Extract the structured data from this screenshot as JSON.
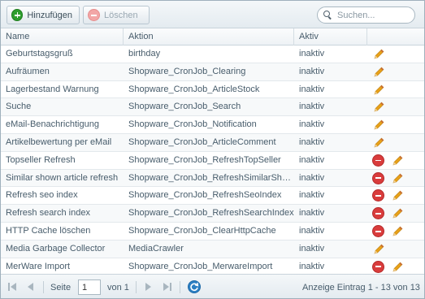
{
  "toolbar": {
    "add_label": "Hinzufügen",
    "delete_label": "Löschen",
    "search_placeholder": "Suchen..."
  },
  "grid": {
    "columns": [
      "Name",
      "Aktion",
      "Aktiv",
      ""
    ],
    "rows": [
      {
        "name": "Geburtstagsgruß",
        "action": "birthday",
        "active": "inaktiv",
        "deletable": false
      },
      {
        "name": "Aufräumen",
        "action": "Shopware_CronJob_Clearing",
        "active": "inaktiv",
        "deletable": false
      },
      {
        "name": "Lagerbestand Warnung",
        "action": "Shopware_CronJob_ArticleStock",
        "active": "inaktiv",
        "deletable": false
      },
      {
        "name": "Suche",
        "action": "Shopware_CronJob_Search",
        "active": "inaktiv",
        "deletable": false
      },
      {
        "name": "eMail-Benachrichtigung",
        "action": "Shopware_CronJob_Notification",
        "active": "inaktiv",
        "deletable": false
      },
      {
        "name": "Artikelbewertung per eMail",
        "action": "Shopware_CronJob_ArticleComment",
        "active": "inaktiv",
        "deletable": false
      },
      {
        "name": "Topseller Refresh",
        "action": "Shopware_CronJob_RefreshTopSeller",
        "active": "inaktiv",
        "deletable": true
      },
      {
        "name": "Similar shown article refresh",
        "action": "Shopware_CronJob_RefreshSimilarShownArticles",
        "active": "inaktiv",
        "deletable": true
      },
      {
        "name": "Refresh seo index",
        "action": "Shopware_CronJob_RefreshSeoIndex",
        "active": "inaktiv",
        "deletable": true
      },
      {
        "name": "Refresh search index",
        "action": "Shopware_CronJob_RefreshSearchIndex",
        "active": "inaktiv",
        "deletable": true
      },
      {
        "name": "HTTP Cache löschen",
        "action": "Shopware_CronJob_ClearHttpCache",
        "active": "inaktiv",
        "deletable": true
      },
      {
        "name": "Media Garbage Collector",
        "action": "MediaCrawler",
        "active": "inaktiv",
        "deletable": false
      },
      {
        "name": "MerWare Import",
        "action": "Shopware_CronJob_MerwareImport",
        "active": "inaktiv",
        "deletable": true
      }
    ]
  },
  "pager": {
    "page_label": "Seite",
    "page_value": "1",
    "of_label": "von 1",
    "summary": "Anzeige Eintrag 1 - 13 von 13"
  },
  "colors": {
    "accent": "#2b7fc3",
    "add_green": "#2e9e2e",
    "delete_red": "#d93c3c",
    "edit_orange": "#e8a21a"
  }
}
